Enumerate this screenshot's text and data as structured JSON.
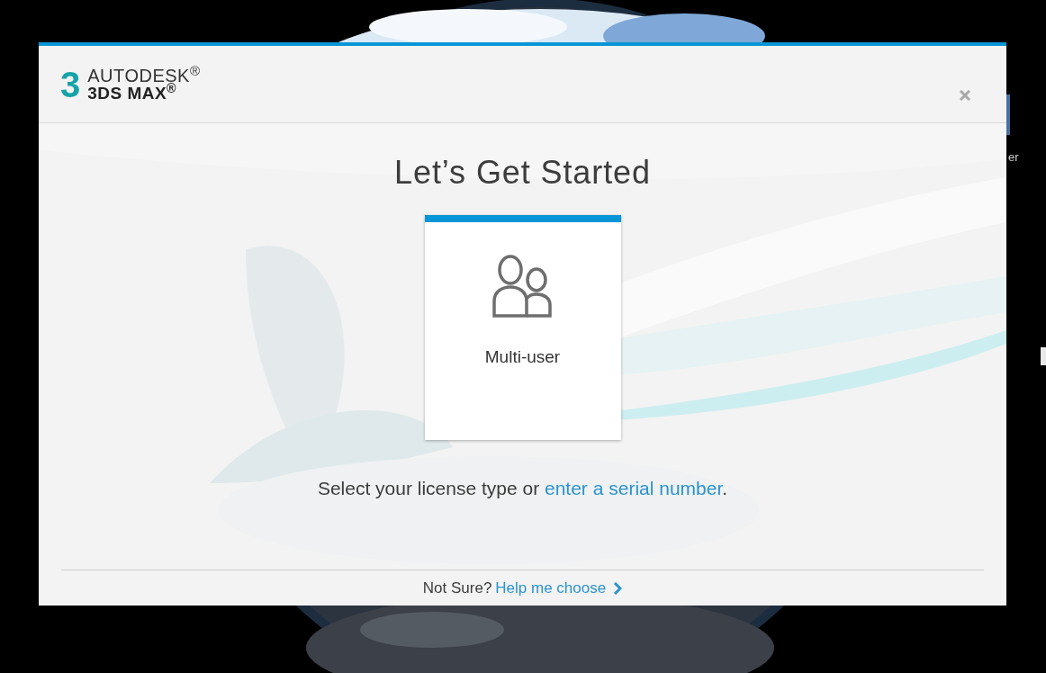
{
  "desktop": {
    "icon_label": "er"
  },
  "dialog": {
    "logo": {
      "numeral": "3",
      "brand": "AUTODESK$^{®}$",
      "product": "3DS MAX$^{®}$"
    },
    "title": "Let’s Get Started",
    "options": [
      {
        "label": "Multi-user"
      }
    ],
    "prompt": {
      "text": "Select your license type or ",
      "link": "enter a serial number",
      "end": "."
    },
    "footer": {
      "text": "Not Sure?",
      "link": "Help me choose"
    }
  }
}
